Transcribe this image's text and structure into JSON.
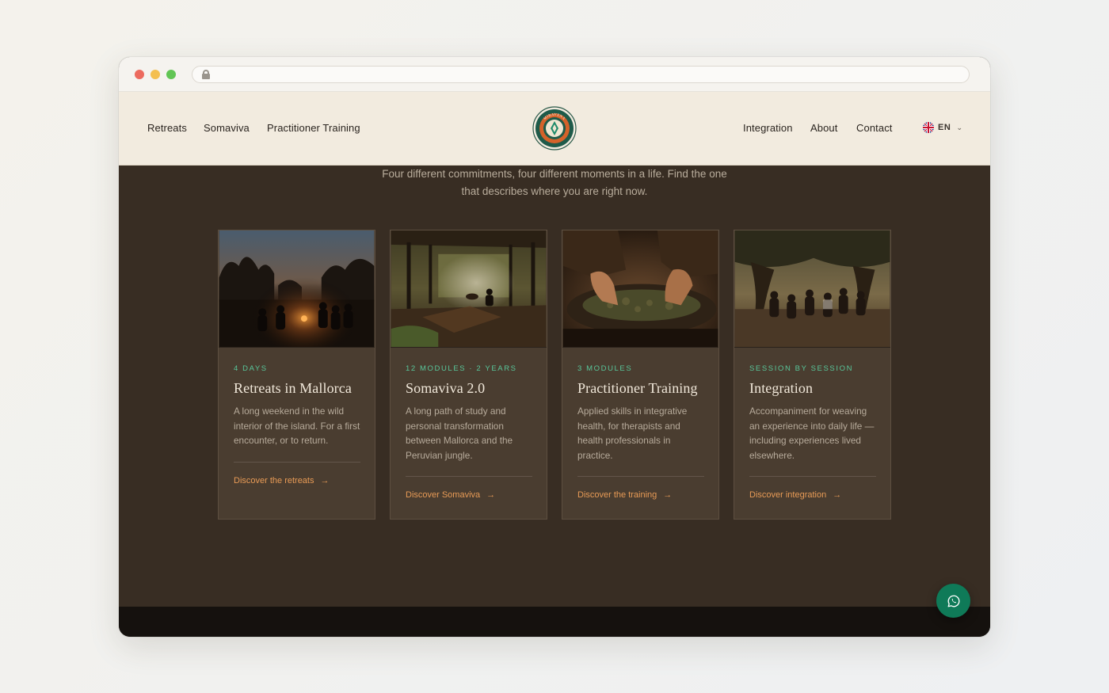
{
  "nav": {
    "left": [
      "Retreats",
      "Somaviva",
      "Practitioner Training"
    ],
    "right": [
      "Integration",
      "About",
      "Contact"
    ],
    "language": "EN"
  },
  "logo": {
    "text": "MIRAVENA"
  },
  "intro": {
    "line1": "Four different commitments, four different moments in a life. Find the one",
    "line2": "that describes where you are right now."
  },
  "cards": [
    {
      "eyebrow": "4 DAYS",
      "title": "Retreats in Mallorca",
      "desc": "A long weekend in the wild interior of the island. For a first encounter, or to return.",
      "cta": "Discover the retreats",
      "image": "campfire-night-scene"
    },
    {
      "eyebrow": "12 MODULES · 2 YEARS",
      "title": "Somaviva 2.0",
      "desc": "A long path of study and personal transformation between Mallorca and the Peruvian jungle.",
      "cta": "Discover Somaviva",
      "image": "jungle-hut-scene"
    },
    {
      "eyebrow": "3 MODULES",
      "title": "Practitioner Training",
      "desc": "Applied skills in integrative health, for therapists and health professionals in practice.",
      "cta": "Discover the training",
      "image": "hands-herbs-scene"
    },
    {
      "eyebrow": "SESSION BY SESSION",
      "title": "Integration",
      "desc": "Accompaniment for weaving an experience into daily life — including experiences lived elsewhere.",
      "cta": "Discover integration",
      "image": "group-under-tree-scene"
    }
  ],
  "colors": {
    "accent_green": "#58c69a",
    "accent_orange": "#e89b56",
    "background_dark": "#382d23",
    "card_bg": "#4a3d30",
    "nav_bg": "#f2ebdf",
    "whatsapp": "#0f7a58"
  },
  "icons": {
    "whatsapp": "whatsapp-icon",
    "flag": "uk-flag-icon",
    "arrow": "arrow-right-icon"
  }
}
